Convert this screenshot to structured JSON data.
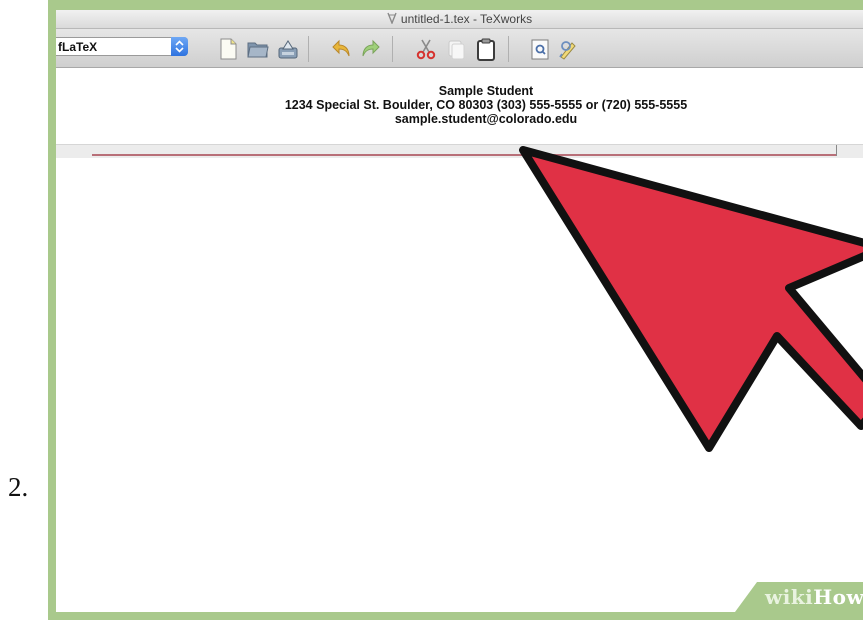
{
  "step_number": "2.",
  "window": {
    "title": "untitled-1.tex - TeXworks"
  },
  "toolbar": {
    "engine_value": "fLaTeX",
    "icons": [
      "new-document-icon",
      "open-folder-icon",
      "save-icon",
      "undo-icon",
      "redo-icon",
      "cut-icon",
      "copy-icon",
      "paste-icon",
      "find-icon",
      "replace-icon"
    ]
  },
  "document": {
    "name": "Sample Student",
    "address_line": "1234 Special St. Boulder, CO 80303 (303) 555-5555 or (720) 555-5555",
    "email": "sample.student@colorado.edu",
    "rule_color": "#b86f78"
  },
  "overlay": {
    "arrow_color": "#e03145",
    "arrow_outline": "#111111"
  },
  "watermark": {
    "wiki": "wiki",
    "how": "How",
    "color": "#a9c98c"
  }
}
